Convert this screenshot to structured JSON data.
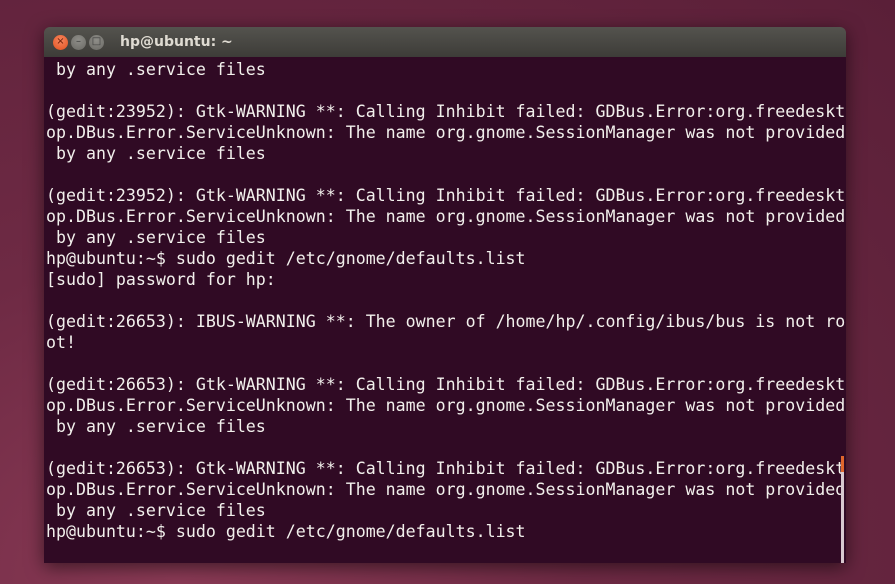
{
  "window": {
    "title": "hp@ubuntu: ~",
    "buttons": {
      "close": "×",
      "minimize": "–",
      "maximize": "□"
    }
  },
  "terminal": {
    "lines": [
      " by any .service files",
      "",
      "(gedit:23952): Gtk-WARNING **: Calling Inhibit failed: GDBus.Error:org.freedeskt",
      "op.DBus.Error.ServiceUnknown: The name org.gnome.SessionManager was not provided",
      " by any .service files",
      "",
      "(gedit:23952): Gtk-WARNING **: Calling Inhibit failed: GDBus.Error:org.freedeskt",
      "op.DBus.Error.ServiceUnknown: The name org.gnome.SessionManager was not provided",
      " by any .service files",
      "hp@ubuntu:~$ sudo gedit /etc/gnome/defaults.list",
      "[sudo] password for hp:",
      "",
      "(gedit:26653): IBUS-WARNING **: The owner of /home/hp/.config/ibus/bus is not ro",
      "ot!",
      "",
      "(gedit:26653): Gtk-WARNING **: Calling Inhibit failed: GDBus.Error:org.freedeskt",
      "op.DBus.Error.ServiceUnknown: The name org.gnome.SessionManager was not provided",
      " by any .service files",
      "",
      "(gedit:26653): Gtk-WARNING **: Calling Inhibit failed: GDBus.Error:org.freedeskt",
      "op.DBus.Error.ServiceUnknown: The name org.gnome.SessionManager was not provided",
      " by any .service files",
      "hp@ubuntu:~$ sudo gedit /etc/gnome/defaults.list"
    ]
  },
  "colors": {
    "terminal_bg": "#300a24",
    "text": "#f2f0ec",
    "close_button": "#e2511f"
  }
}
